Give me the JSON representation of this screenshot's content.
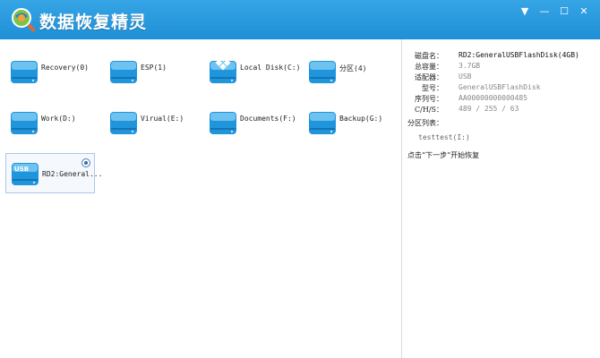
{
  "app": {
    "title": "数据恢复精灵"
  },
  "window_controls": {
    "dropdown": "▼",
    "minimize": "—",
    "maximize": "☐",
    "close": "✕"
  },
  "drives": [
    {
      "label": "Recovery(0)",
      "icon": "drive-icon"
    },
    {
      "label": "ESP(1)",
      "icon": "drive-icon"
    },
    {
      "label": "Local Disk(C:)",
      "icon": "windows-drive-icon"
    },
    {
      "label": "分区(4)",
      "icon": "drive-icon"
    },
    {
      "label": "Work(D:)",
      "icon": "drive-icon"
    },
    {
      "label": "Virual(E:)",
      "icon": "drive-icon"
    },
    {
      "label": "Documents(F:)",
      "icon": "drive-icon"
    },
    {
      "label": "Backup(G:)",
      "icon": "drive-icon"
    },
    {
      "label": "RD2:General...",
      "icon": "usb-drive-icon",
      "badge": "USB",
      "selected": true
    }
  ],
  "details": {
    "rows": [
      {
        "label": "磁盘名：",
        "value": "RD2:GeneralUSBFlashDisk(4GB)"
      },
      {
        "label": "总容量：",
        "value": "3.7GB"
      },
      {
        "label": "适配器：",
        "value": "USB"
      },
      {
        "label": "型号：",
        "value": "GeneralUSBFlashDisk"
      },
      {
        "label": "序列号：",
        "value": "AA00000000000485"
      },
      {
        "label": "C/H/S：",
        "value": "489 / 255 / 63"
      }
    ],
    "partition_heading": "分区列表：",
    "partitions": [
      "testtest(I:)"
    ],
    "hint": "点击“下一步”开始恢复"
  },
  "colors": {
    "titlebar": "#2196db",
    "drive_body": "#1f95dc",
    "accent": "#2f6db0"
  }
}
